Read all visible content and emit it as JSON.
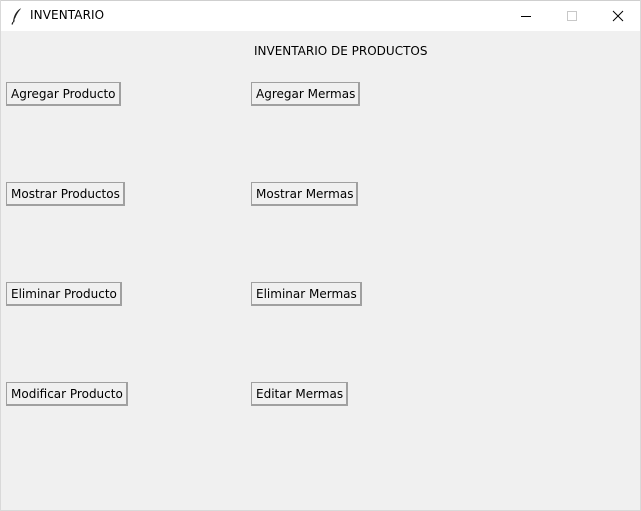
{
  "window": {
    "title": "INVENTARIO",
    "app_icon": "feather-icon",
    "controls": {
      "minimize_icon": "minimize-icon",
      "maximize_icon": "maximize-icon",
      "close_icon": "close-icon"
    }
  },
  "main": {
    "heading": "INVENTARIO DE PRODUCTOS",
    "products": {
      "add_label": "Agregar Producto",
      "show_label": "Mostrar Productos",
      "delete_label": "Eliminar Producto",
      "modify_label": "Modificar Producto"
    },
    "waste": {
      "add_label": "Agregar Mermas",
      "show_label": "Mostrar Mermas",
      "delete_label": "Eliminar Mermas",
      "edit_label": "Editar Mermas"
    }
  },
  "colors": {
    "background": "#f0f0f0",
    "titlebar": "#ffffff",
    "button_face": "#f0f0f0",
    "button_shadow": "#696969"
  }
}
